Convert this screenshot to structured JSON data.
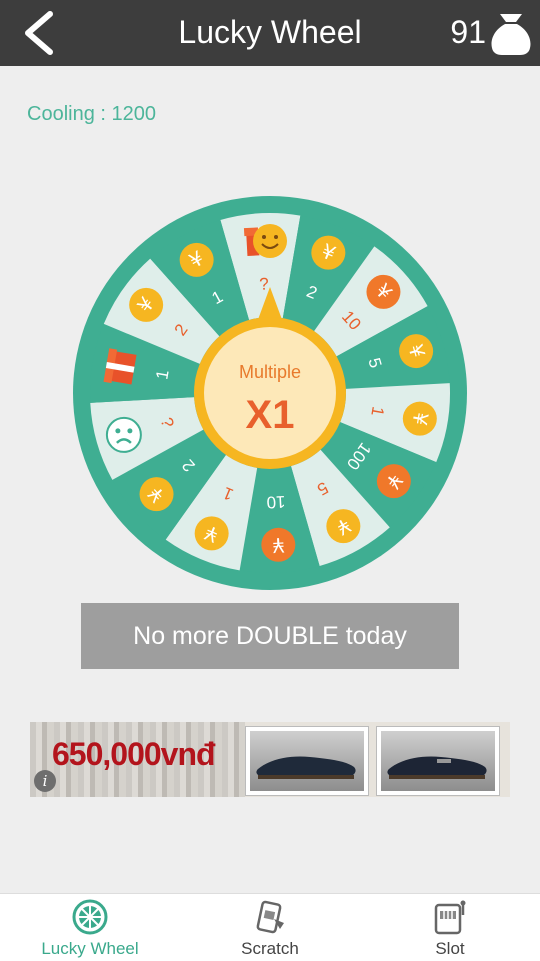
{
  "header": {
    "title": "Lucky Wheel",
    "coins": "91"
  },
  "cooling": "Cooling : 1200",
  "wheel": {
    "center_label": "Multiple",
    "center_value": "X1",
    "labels": [
      "?",
      "2",
      "10",
      "5",
      "1",
      "100",
      "5",
      "10",
      "1",
      "2",
      "¿",
      "1",
      "2",
      "1"
    ]
  },
  "double_button": "No more DOUBLE today",
  "ad": {
    "price": "650,000vnđ",
    "info": "i"
  },
  "nav": [
    {
      "label": "Lucky Wheel",
      "active": true
    },
    {
      "label": "Scratch",
      "active": false
    },
    {
      "label": "Slot",
      "active": false
    }
  ],
  "colors": {
    "accent": "#3aa98c",
    "teal_wheel": "#3fae92",
    "coin_yellow": "#f6b621",
    "coin_orange": "#f0782a"
  }
}
